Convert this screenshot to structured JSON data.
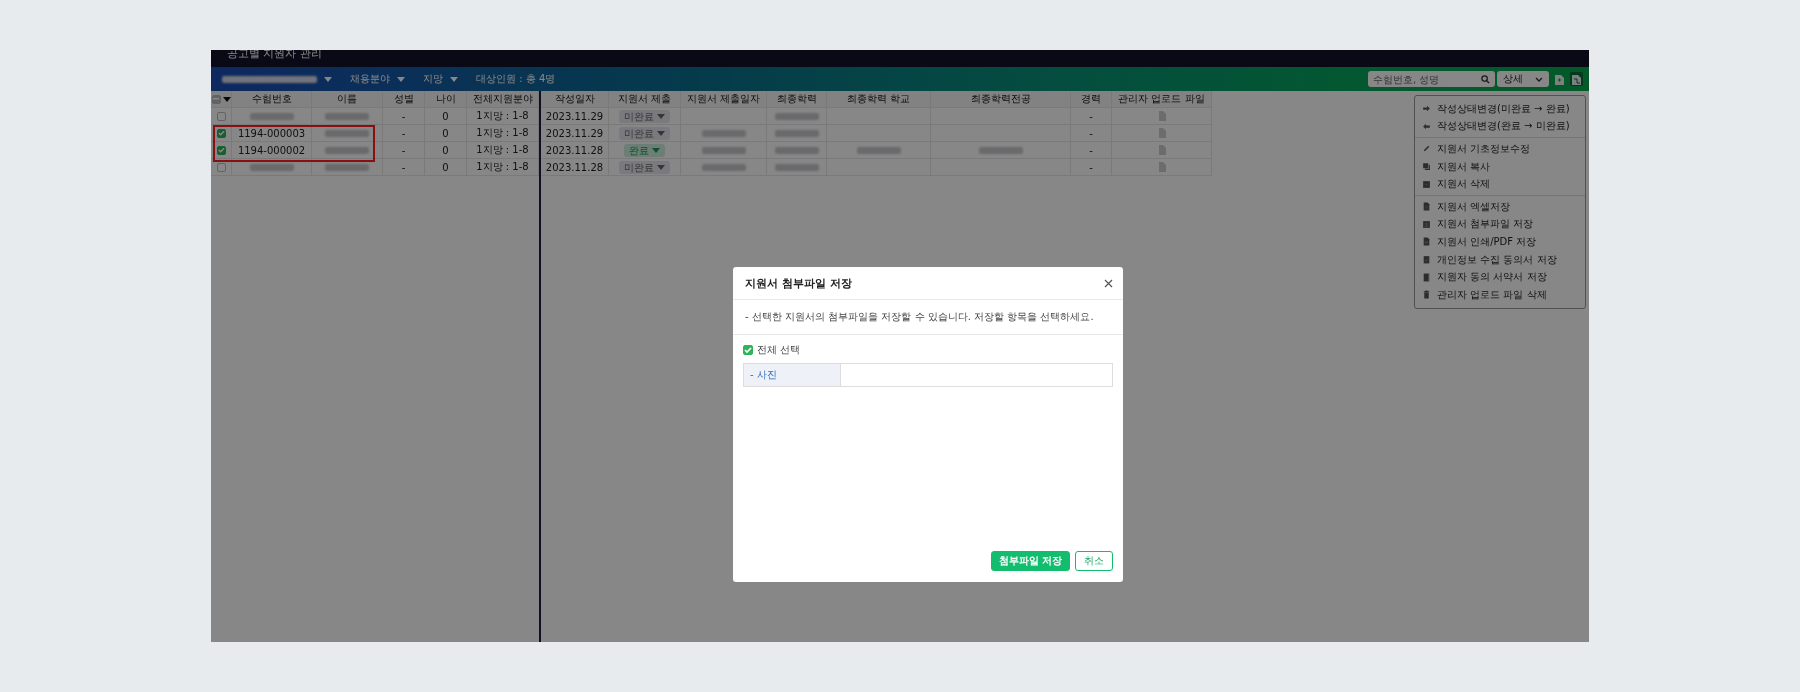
{
  "window": {
    "title": "공고별 지원자 관리"
  },
  "toolbar": {
    "filters": [
      {
        "kind": "redacted"
      },
      {
        "kind": "dropdown",
        "label": "채용분야"
      },
      {
        "kind": "dropdown",
        "label": "지망"
      }
    ],
    "target_count": "대상인원 : 총 4명",
    "search": {
      "placeholder": "수험번호, 성명"
    },
    "view_select": "상세"
  },
  "table": {
    "header_checkbox": {
      "partial": true
    },
    "columns_left": [
      "수험번호",
      "이름",
      "성별",
      "나이",
      "전체지원분야"
    ],
    "columns_right": [
      "작성일자",
      "지원서 제출",
      "지원서 제출일자",
      "최종학력",
      "최종학력 학교",
      "최종학력전공",
      "경력",
      "관리자 업로드 파일"
    ],
    "rows": [
      {
        "checked": false,
        "highlighted": false,
        "cells": [
          {
            "kind": "redacted"
          },
          {
            "kind": "redacted"
          },
          "-",
          "0",
          "1지망 : 1-8",
          "2023.11.29",
          {
            "kind": "status",
            "label": "미완료",
            "done": false
          },
          null,
          {
            "kind": "redacted"
          },
          null,
          null,
          "-",
          {
            "kind": "file"
          }
        ]
      },
      {
        "checked": true,
        "highlighted": true,
        "cells": [
          "1194-000003",
          {
            "kind": "redacted"
          },
          "-",
          "0",
          "1지망 : 1-8",
          "2023.11.29",
          {
            "kind": "status",
            "label": "미완료",
            "done": false
          },
          {
            "kind": "redacted"
          },
          {
            "kind": "redacted"
          },
          null,
          null,
          "-",
          {
            "kind": "file"
          }
        ]
      },
      {
        "checked": true,
        "highlighted": true,
        "cells": [
          "1194-000002",
          {
            "kind": "redacted"
          },
          "-",
          "0",
          "1지망 : 1-8",
          "2023.11.28",
          {
            "kind": "status",
            "label": "완료",
            "done": true
          },
          {
            "kind": "redacted"
          },
          {
            "kind": "redacted"
          },
          {
            "kind": "redacted"
          },
          {
            "kind": "redacted"
          },
          "-",
          {
            "kind": "file"
          }
        ]
      },
      {
        "checked": false,
        "highlighted": false,
        "cells": [
          {
            "kind": "redacted"
          },
          {
            "kind": "redacted"
          },
          "-",
          "0",
          "1지망 : 1-8",
          "2023.11.28",
          {
            "kind": "status",
            "label": "미완료",
            "done": false
          },
          {
            "kind": "redacted"
          },
          {
            "kind": "redacted"
          },
          null,
          null,
          "-",
          {
            "kind": "file"
          }
        ]
      }
    ]
  },
  "action_menu": {
    "groups": [
      [
        "작성상태변경(미완료 → 완료)",
        "작성상태변경(완료 → 미완료)"
      ],
      [
        "지원서 기초정보수정",
        "지원서 복사",
        "지원서 삭제"
      ],
      [
        "지원서 엑셀저장",
        "지원서 첨부파일 저장",
        "지원서 인쇄/PDF 저장",
        "개인정보 수집 동의서 저장",
        "지원자 동의 서약서 저장",
        "관리자 업로드 파일 삭제"
      ]
    ]
  },
  "dialog": {
    "title": "지원서 첨부파일 저장",
    "description": "- 선택한 지원서의 첨부파일을 저장할 수 있습니다. 저장할 항목을 선택하세요.",
    "select_all": {
      "label": "전체 선택",
      "checked": true
    },
    "items": [
      {
        "label": "- 사진"
      }
    ],
    "buttons": [
      {
        "label": "첨부파일 저장",
        "kind": "primary"
      },
      {
        "label": "취소",
        "kind": "secondary"
      }
    ]
  }
}
